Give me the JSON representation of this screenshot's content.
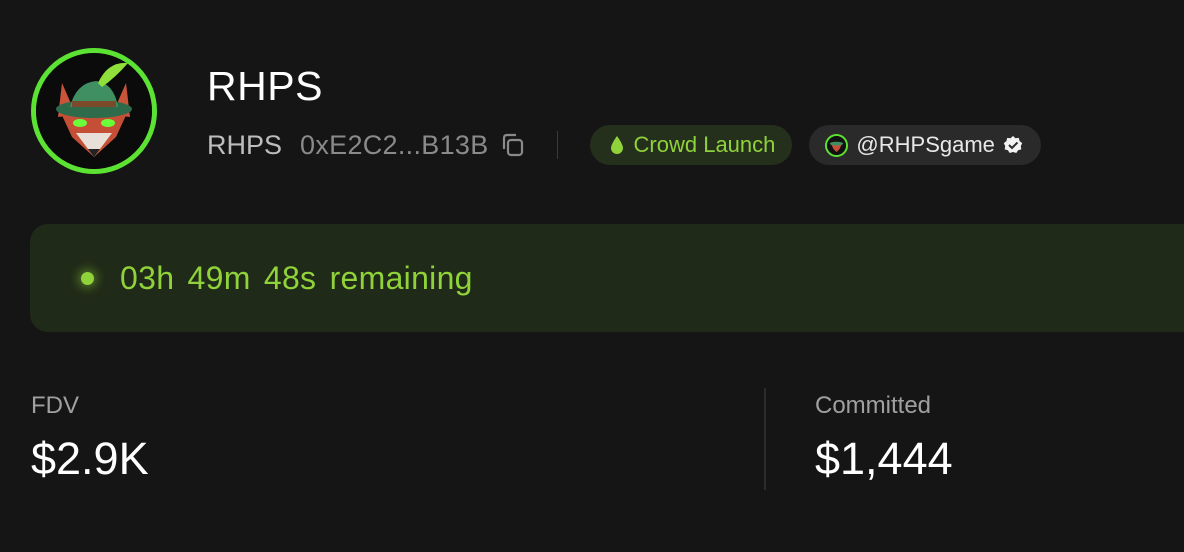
{
  "token": {
    "name": "RHPS",
    "ticker": "RHPS",
    "address_short": "0xE2C2...B13B",
    "avatar_icon": "fox-with-green-hat-icon"
  },
  "badges": {
    "launch_label": "Crowd Launch",
    "launch_icon": "drop-icon",
    "handle": "@RHPSgame",
    "verified_icon": "verified-check-icon"
  },
  "countdown": {
    "hours": "03h",
    "minutes": "49m",
    "seconds": "48s",
    "suffix": "remaining"
  },
  "stats": {
    "fdv_label": "FDV",
    "fdv_value": "$2.9K",
    "committed_label": "Committed",
    "committed_value": "$1,444"
  },
  "colors": {
    "accent_green": "#8fd23a",
    "avatar_ring": "#5be232",
    "background": "#151515"
  }
}
